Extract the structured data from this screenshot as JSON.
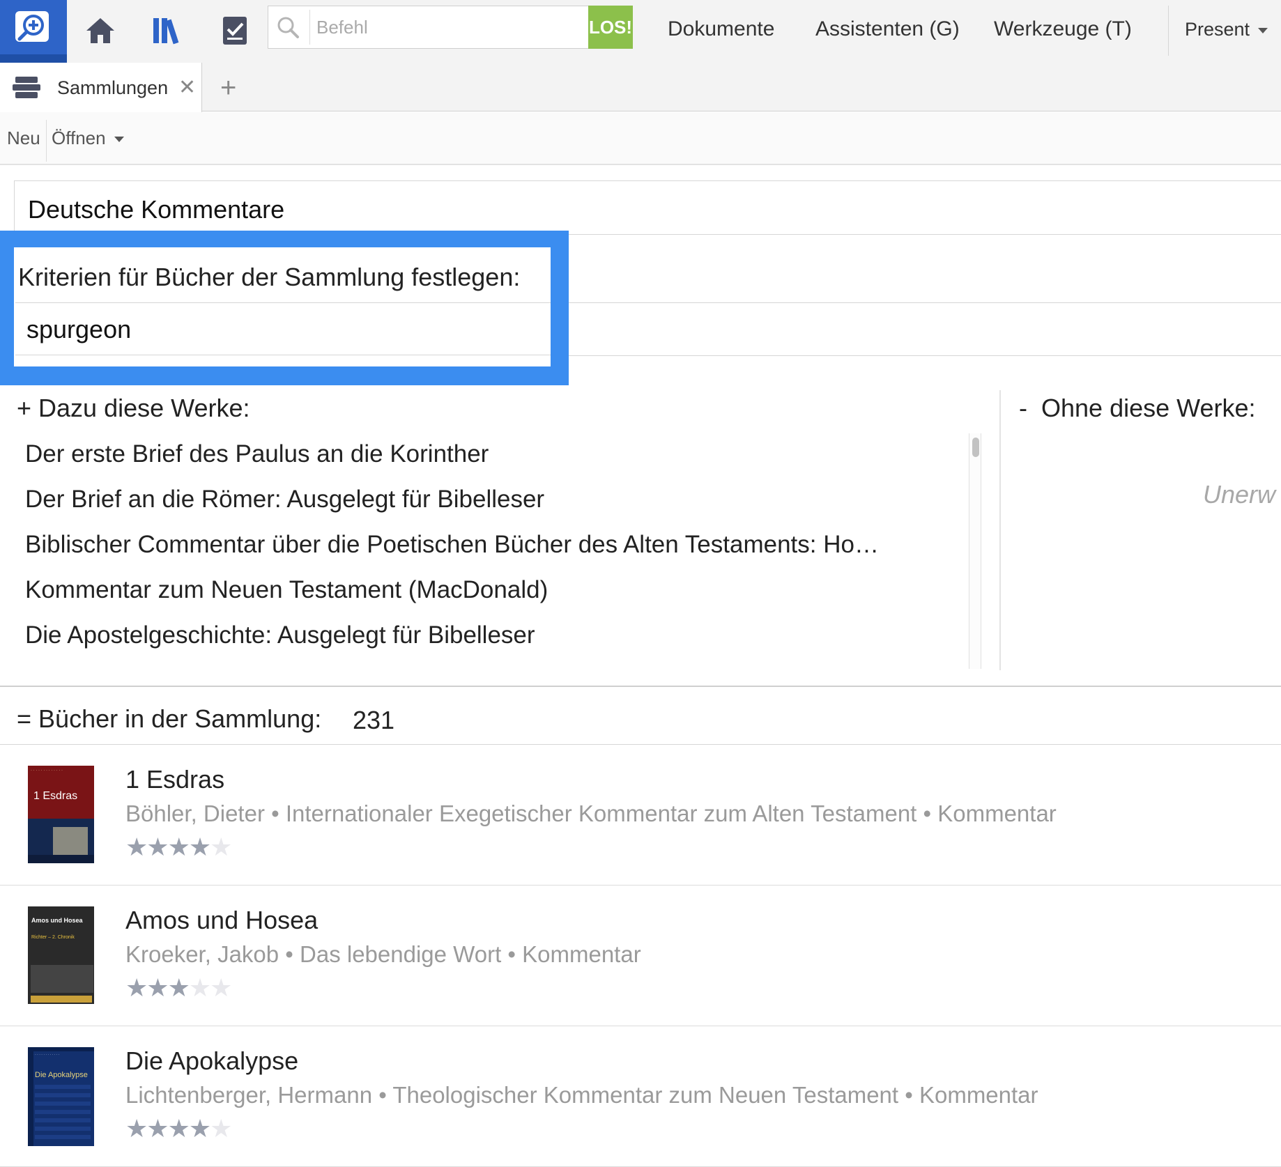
{
  "topbar": {
    "command_placeholder": "Befehl",
    "go_label": "LOS!",
    "menus": [
      "Dokumente",
      "Assistenten (G)",
      "Werkzeuge (T)"
    ],
    "present_label": "Present"
  },
  "tabs": [
    {
      "label": "Sammlungen"
    }
  ],
  "toolbar": {
    "new_label": "Neu",
    "open_label": "Öffnen"
  },
  "collection": {
    "name": "Deutsche Kommentare"
  },
  "criteria": {
    "label": "Kriterien für Bücher der Sammlung festlegen:",
    "value": "spurgeon"
  },
  "include": {
    "header": "Dazu diese Werke:",
    "items": [
      "Der erste Brief des Paulus an die Korinther",
      "Der Brief an die Römer: Ausgelegt für Bibelleser",
      "Biblischer Commentar über die Poetischen Bücher des Alten Testaments: Ho…",
      "Kommentar zum Neuen Testament (MacDonald)",
      "Die Apostelgeschichte: Ausgelegt für Bibelleser"
    ]
  },
  "exclude": {
    "header": "Ohne diese Werke:",
    "empty_text": "Unerw"
  },
  "results": {
    "label": "Bücher in der Sammlung:",
    "count": "231",
    "books": [
      {
        "title": "1 Esdras",
        "meta": "Böhler, Dieter • Internationaler Exegetischer Kommentar zum Alten Testament • Kommentar",
        "rating": 4,
        "cover_text": "1 Esdras",
        "cover_color": "#7a1416"
      },
      {
        "title": "Amos und Hosea",
        "meta": "Kroeker, Jakob • Das lebendige Wort • Kommentar",
        "rating": 3,
        "cover_text": "Amos und Hosea",
        "cover_subtext": "Richter – 2. Chronik",
        "cover_color": "#2a2a2a"
      },
      {
        "title": "Die Apokalypse",
        "meta": "Lichtenberger, Hermann • Theologischer Kommentar zum Neuen Testament • Kommentar",
        "rating": 4,
        "cover_text": "Die Apokalypse",
        "cover_color": "#13306e"
      }
    ]
  },
  "colors": {
    "accent_blue": "#3b8df0",
    "go_green": "#8cc04b",
    "logo_blue": "#2e64c8"
  }
}
